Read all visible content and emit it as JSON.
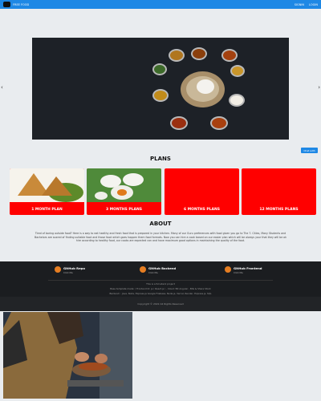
{
  "nav": {
    "brand": "FREE FOOD",
    "links": [
      "SIGNIN",
      "LOGIN"
    ]
  },
  "carousel": {
    "prev_icon": "‹",
    "next_icon": "›"
  },
  "chat_button": "Chat with",
  "plans": {
    "title": "PLANS",
    "items": [
      "1 MONTH PLAN",
      "3 MONTHS PLANS",
      "6 MONTHS PLANS",
      "12 MONTHS PLANS"
    ]
  },
  "about": {
    "title": "ABOUT",
    "text": "Tired of boring outside food? Here is a way to eat healthy and fresh food that is prepared in your kitchen. Many of our Guru preferences with food given you go to The 7. Cities, Many Students and Bachelors are scared of finding suitable food and those food which goes happen them food formats. Now you can hire a cook based on our easier plan which will be always your that they will be ok hire according to healthy food, our cooks are expected can and have maximum good options in maintaining the quality of the food."
  },
  "footer": {
    "repos": [
      {
        "title": "GitHub Repo",
        "sub": "Click Me"
      },
      {
        "title": "GitHub Backend",
        "sub": "Click Me"
      },
      {
        "title": "GitHub Frontend",
        "sub": "Click Me"
      }
    ],
    "heading": "This is a full-stack project",
    "frontend": "Base template made: ( Frontend UI: js ( React.js ) , Cloud: Bit Angular , Bits & Share Stock",
    "backend": "Backend: : Java, Node, Express.js Google Firebase, Node.js, Vercel, Render, Express.js, SQL",
    "copyright": "Copyright © 2022 All Rights Reserved"
  }
}
